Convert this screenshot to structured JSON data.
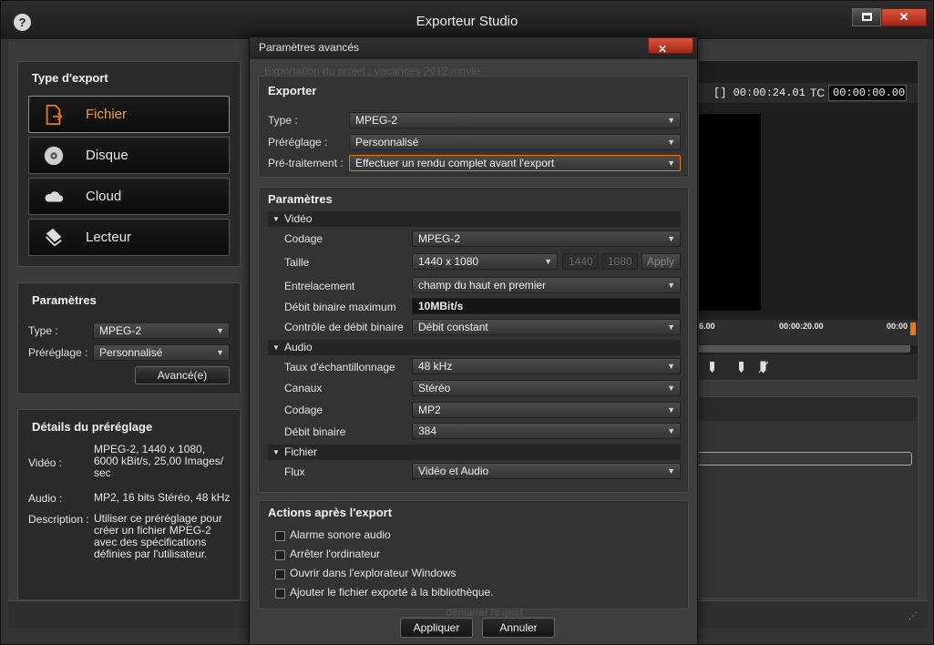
{
  "window": {
    "title": "Exporteur Studio"
  },
  "export_type": {
    "title": "Type d'export",
    "items": [
      {
        "label": "Fichier",
        "icon": "file-export-icon"
      },
      {
        "label": "Disque",
        "icon": "disc-icon"
      },
      {
        "label": "Cloud",
        "icon": "cloud-icon"
      },
      {
        "label": "Lecteur",
        "icon": "device-icon"
      }
    ]
  },
  "left_params": {
    "title": "Paramètres",
    "type_label": "Type :",
    "type_value": "MPEG-2",
    "preset_label": "Préréglage :",
    "preset_value": "Personnalisé",
    "advanced_button": "Avancé(e)"
  },
  "preset_details": {
    "title": "Détails du préréglage",
    "video_label": "Vidéo :",
    "video_value": "MPEG-2, 1440 x 1080, 6000 kBit/s, 25,00 Images/ sec",
    "audio_label": "Audio :",
    "audio_value": "MP2, 16 bits Stéréo, 48 kHz",
    "description_label": "Description :",
    "description_value": "Utiliser ce préréglage pour créer un fichier MPEG-2 avec des spécifications définies par l'utilisateur."
  },
  "preview": {
    "timecode_position": "[] 00:00:24.01",
    "tc_label": "TC",
    "tc_value": "00:00:00.00",
    "ruler_marks": [
      "6.00",
      "00:00:20.00",
      "00:00"
    ]
  },
  "dialog": {
    "title": "Paramètres avancés",
    "background_text": "Exportation du projet : vacances 2012.movie",
    "export_section": {
      "title": "Exporter",
      "type_label": "Type :",
      "type_value": "MPEG-2",
      "preset_label": "Préréglage :",
      "preset_value": "Personnalisé",
      "pretreat_label": "Pré-traitement :",
      "pretreat_value": "Effectuer un rendu complet avant l'export"
    },
    "params_section": {
      "title": "Paramètres",
      "video_group": "Vidéo",
      "codec_label": "Codage",
      "codec_value": "MPEG-2",
      "size_label": "Taille",
      "size_value": "1440 x 1080",
      "width_value": "1440",
      "height_value": "1080",
      "apply_button": "Apply",
      "interlace_label": "Entrelacement",
      "interlace_value": "champ du haut en premier",
      "maxrate_label": "Débit binaire maximum",
      "maxrate_value": "10MBit/s",
      "maxrate_level": 0.0,
      "ratectl_label": "Contrôle de débit binaire",
      "ratectl_value": "Débit constant",
      "audio_group": "Audio",
      "samplerate_label": "Taux d'échantillonnage",
      "samplerate_value": "48 kHz",
      "channels_label": "Canaux",
      "channels_value": "Stéréo",
      "acodec_label": "Codage",
      "acodec_value": "MP2",
      "abitrate_label": "Débit binaire",
      "abitrate_value": "384",
      "file_group": "Fichier",
      "stream_label": "Flux",
      "stream_value": "Vidéo et Audio"
    },
    "actions_section": {
      "title": "Actions après l'export",
      "items": [
        "Alarme sonore audio",
        "Arrêter l'ordinateur",
        "Ouvrir dans l'explorateur Windows",
        "Ajouter le fichier exporté à la bibliothèque."
      ]
    },
    "apply_button": "Appliquer",
    "cancel_button": "Annuler",
    "ghost_bottom": "Démarrer l'export"
  },
  "colors": {
    "accent": "#e07a1e",
    "close": "#c23a26"
  }
}
